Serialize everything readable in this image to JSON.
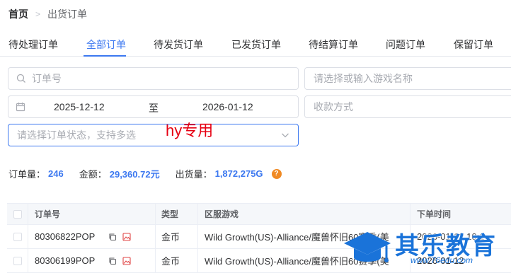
{
  "breadcrumb": {
    "home": "首页",
    "separator": ">",
    "current": "出货订单"
  },
  "tabs": [
    {
      "label": "待处理订单"
    },
    {
      "label": "全部订单"
    },
    {
      "label": "待发货订单"
    },
    {
      "label": "已发货订单"
    },
    {
      "label": "待结算订单"
    },
    {
      "label": "问题订单"
    },
    {
      "label": "保留订单"
    }
  ],
  "active_tab": "全部订单",
  "filters": {
    "order_placeholder": "订单号",
    "game_placeholder": "请选择或输入游戏名称",
    "date_start": "2025-12-12",
    "date_to": "至",
    "date_end": "2026-01-12",
    "payment_placeholder": "收款方式",
    "status_placeholder": "请选择订单状态，支持多选"
  },
  "overlay_text": "hy专用",
  "stats": {
    "order_count_label": "订单量：",
    "order_count": "246",
    "amount_label": "金额：",
    "amount": "29,360.72元",
    "shipped_label": "出货量：",
    "shipped": "1,872,275G",
    "help": "?"
  },
  "table": {
    "headers": {
      "order_no": "订单号",
      "type": "类型",
      "server_game": "区服游戏",
      "order_time": "下单时间"
    },
    "rows": [
      {
        "order_no": "80306822POP",
        "type": "金币",
        "server_game": "Wild Growth(US)-Alliance/魔兽怀旧60赛季(美",
        "order_time": "2026-01-12 10:1"
      },
      {
        "order_no": "80306199POP",
        "type": "金币",
        "server_game": "Wild Growth(US)-Alliance/魔兽怀旧60赛季(美",
        "order_time": "2026-01-12"
      }
    ]
  },
  "watermark": {
    "title": "其乐教育",
    "url": "www.76edu.com"
  },
  "colors": {
    "accent": "#3c78f0",
    "overlay": "#e60012",
    "help": "#f08a24"
  }
}
